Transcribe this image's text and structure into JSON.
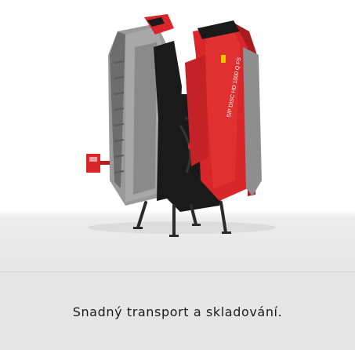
{
  "card": {
    "caption": "Snadný transport a skladování.",
    "image_brand_text": "SIP DISC HD 1000 Q FS"
  },
  "colors": {
    "machine_red": "#d8262a",
    "cover_gray": "#8e8e8e",
    "frame_black": "#1a1a1a",
    "floor_gray": "#e6e6e6",
    "caption_text": "#1c1c1c"
  }
}
